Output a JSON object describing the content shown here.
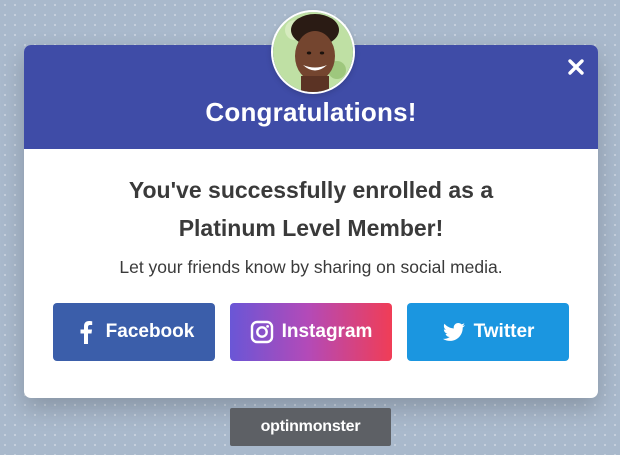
{
  "popup": {
    "title": "Congratulations!",
    "headline_line1": "You've successfully enrolled as a",
    "headline_line2": "Platinum Level Member!",
    "subtext": "Let your friends know by sharing on social media.",
    "close_icon": "close-icon",
    "avatar_icon": "avatar-photo"
  },
  "share": {
    "facebook_label": "Facebook",
    "instagram_label": "Instagram",
    "twitter_label": "Twitter",
    "facebook_icon": "facebook-icon",
    "instagram_icon": "instagram-icon",
    "twitter_icon": "twitter-icon"
  },
  "brand": {
    "name": "optinmonster"
  },
  "colors": {
    "header": "#3f4ca7",
    "facebook": "#3b5eaa",
    "instagram_start": "#6a56d6",
    "instagram_end": "#f03d56",
    "twitter": "#1b96e0",
    "background": "#a9b9cc",
    "brand_bar": "#5d6065"
  }
}
